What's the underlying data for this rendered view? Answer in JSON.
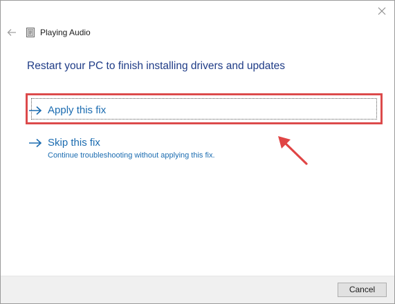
{
  "window": {
    "title": "Playing Audio"
  },
  "heading": "Restart your PC to finish installing drivers and updates",
  "options": [
    {
      "label": "Apply this fix",
      "description": ""
    },
    {
      "label": "Skip this fix",
      "description": "Continue troubleshooting without applying this fix."
    }
  ],
  "footer": {
    "cancel_label": "Cancel"
  },
  "icons": {
    "back": "back-arrow-icon",
    "app": "troubleshooter-app-icon",
    "close": "close-icon",
    "option_arrow": "right-arrow-icon",
    "annotation": "red-pointer-arrow"
  },
  "colors": {
    "heading": "#1e3b86",
    "link": "#1a6bb0",
    "highlight_border": "#dc4a4b",
    "footer_bg": "#f0f0f0"
  }
}
